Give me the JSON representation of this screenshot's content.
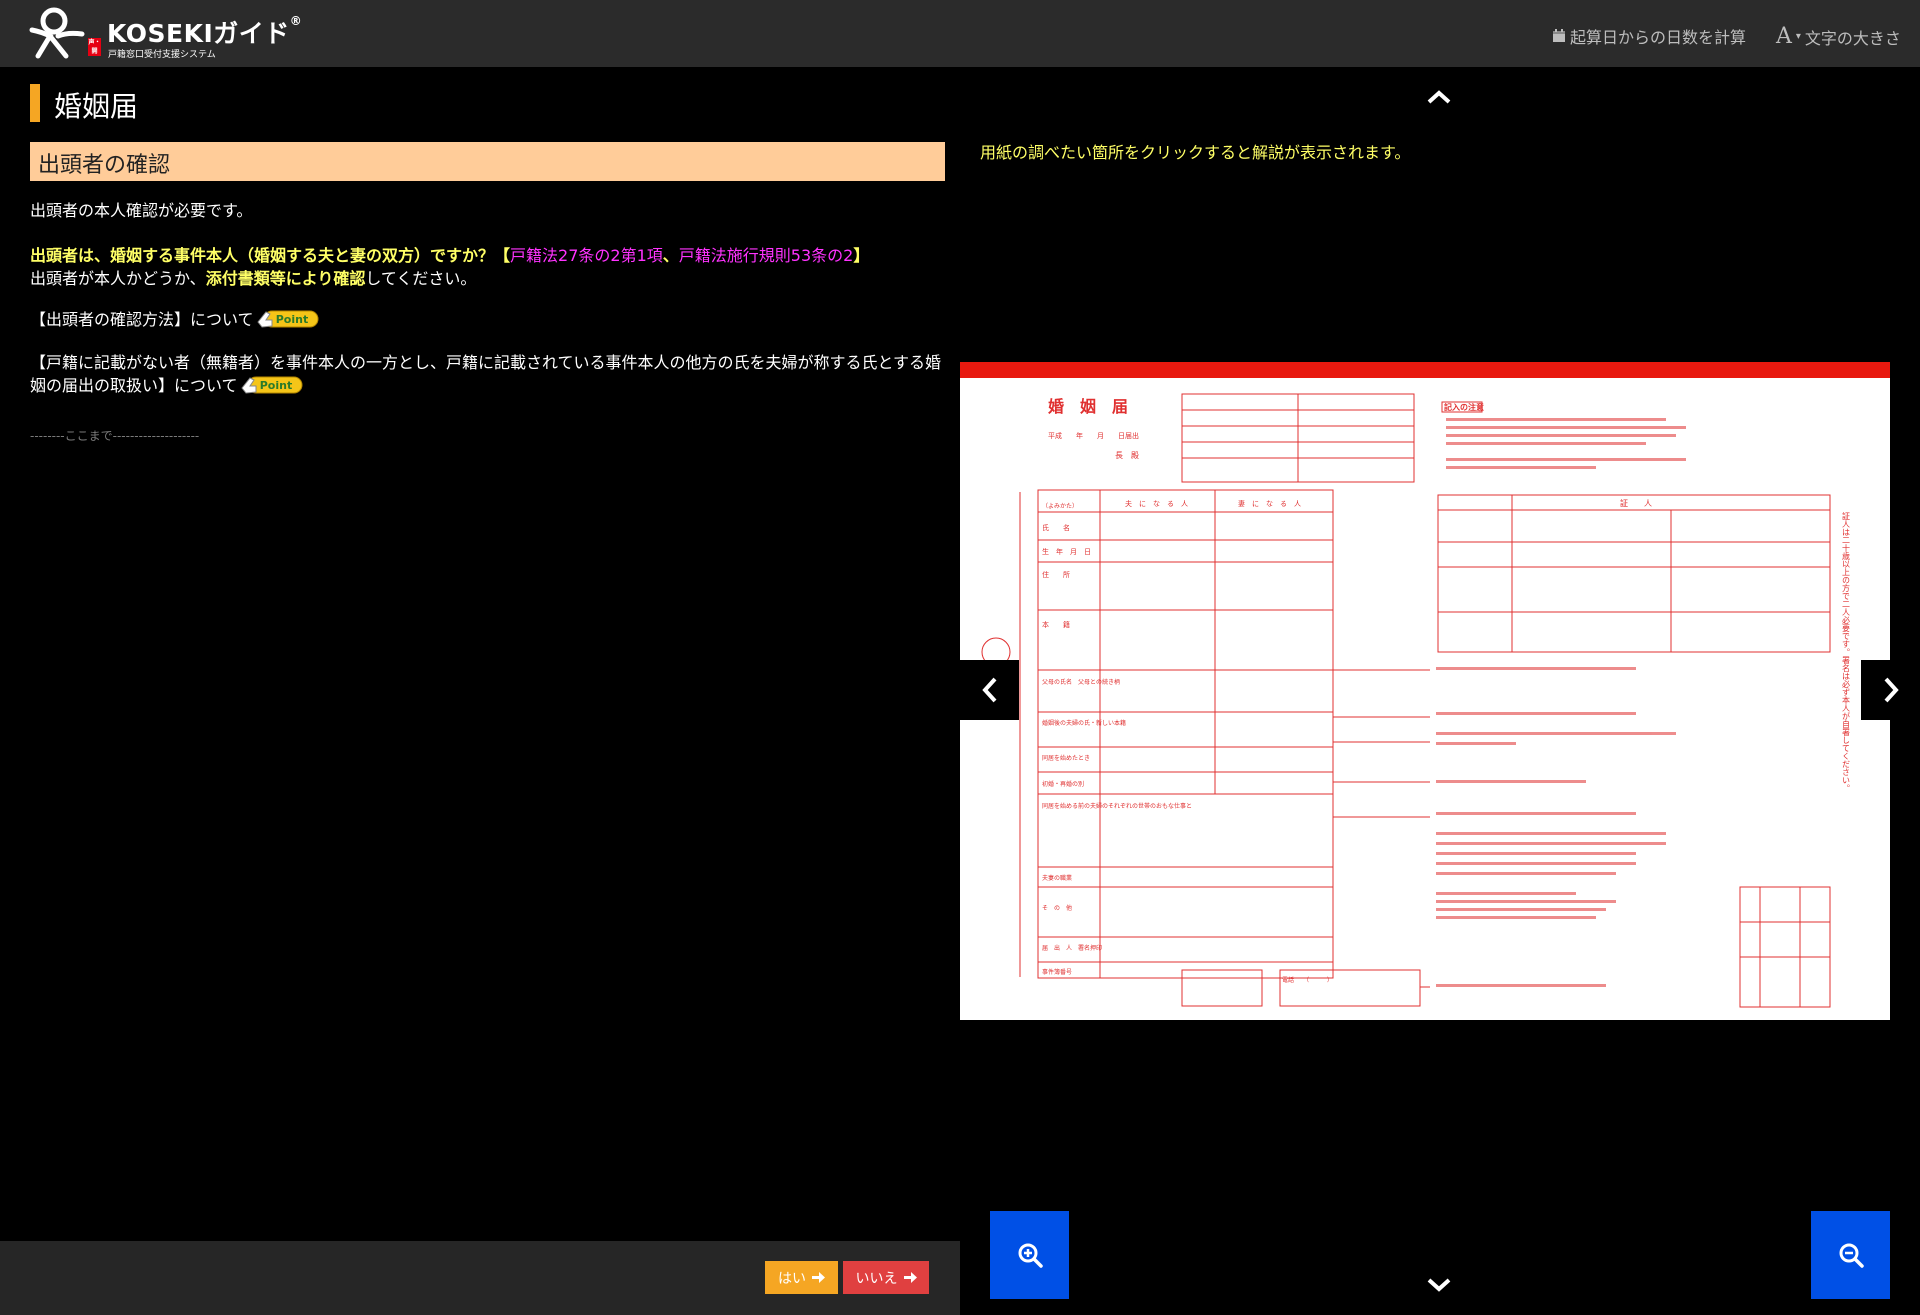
{
  "header": {
    "logo_text": "KOSEKIガイド",
    "logo_trademark": "®",
    "logo_subtitle": "戸籍窓口受付支援システム",
    "logo_badge": "声・開",
    "calc_days_label": "起算日からの日数を計算",
    "font_size_letter": "A",
    "font_size_label": "文字の大きさ"
  },
  "page": {
    "title": "婚姻届",
    "section": "出頭者の確認",
    "line1": "出頭者の本人確認が必要です。",
    "q_part1": "出頭者は、婚姻する事件本人（婚姻する夫と妻の双方）ですか？",
    "q_bracket_open": "【",
    "q_law1": "戸籍法27条の2第1項",
    "q_sep": "、",
    "q_law2": "戸籍法施行規則53条の2",
    "q_bracket_close": "】",
    "line3_part1": "出頭者が本人かどうか、",
    "line3_bold": "添付書類等により確認",
    "line3_part2": "してください。",
    "method_label": "【出頭者の確認方法】について",
    "mukoseki_label": "【戸籍に記載がない者（無籍者）を事件本人の一方とし、戸籍に記載されている事件本人の他方の氏を夫婦が称する氏とする婚姻の届出の取扱い】について",
    "point_label": "Point",
    "end_marker": "--------ここまで--------------------"
  },
  "buttons": {
    "yes": "はい",
    "no": "いいえ"
  },
  "viewer": {
    "hint": "用紙の調べたい箇所をクリックすると解説が表示されます。",
    "form_title": "婚　姻　届",
    "form_date": "平成　　年　　月　　日届出",
    "form_chief": "長　殿",
    "form_notes_title": "記入の注意",
    "form_witness": "証　　人",
    "husband": "夫　に　な　る　人",
    "wife": "妻　に　な　る　人",
    "form_yomikata": "（よみかた）",
    "form_label_name": "氏　　名",
    "form_label_birth": "生　年　月　日",
    "form_label_address": "住　　所",
    "form_label_honseki": "本　　籍",
    "form_label_parents": "父母の氏名　父母との続き柄",
    "form_label_after": "婚姻後の夫婦の氏・新しい本籍",
    "form_label_together": "同居を始めたとき",
    "form_label_first": "初婚・再婚の別",
    "form_label_work": "同居を始める前の夫婦のそれぞれの世帯のおもな仕事と",
    "form_label_job": "夫妻の職業",
    "form_label_other": "そ　の　他",
    "form_label_signer": "届　出　人　署名押印",
    "form_label_case": "事件簿番号",
    "form_phone": "電話　　（　　　）",
    "form_vertical_note": "証人は二十歳以上の方で二人必要です。署名は必ず本人が自署してください。"
  },
  "icons": {
    "calendar": "calendar-icon",
    "chevron_up": "chevron-up-icon",
    "chevron_down": "chevron-down-icon",
    "chevron_left": "chevron-left-icon",
    "chevron_right": "chevron-right-icon",
    "zoom_in": "zoom-in-icon",
    "zoom_out": "zoom-out-icon",
    "arrow_right": "arrow-right-icon"
  },
  "colors": {
    "accent_orange": "#f5a623",
    "section_bg": "#ffcc99",
    "highlight_yellow": "#ffff66",
    "law_magenta": "#ff33ff",
    "no_red": "#e04040",
    "zoom_blue": "#0050e6",
    "form_red": "#e03030"
  }
}
